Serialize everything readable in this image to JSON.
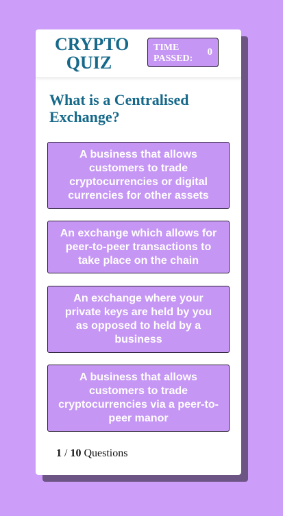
{
  "header": {
    "title": "CRYPTO QUIZ",
    "timer_label": "TIME PASSED:",
    "timer_value": "0"
  },
  "question": {
    "text": "What is a Centralised Exchange?"
  },
  "answers": [
    {
      "label": "A business that allows customers to trade cryptocurrencies or digital currencies for other assets"
    },
    {
      "label": "An exchange which allows for peer-to-peer transactions to take place on the chain"
    },
    {
      "label": "An exchange where your private keys are held by you as opposed to held by a business"
    },
    {
      "label": "A business that allows customers to trade cryptocurrencies via a peer-to-peer manor"
    }
  ],
  "progress": {
    "current": "1",
    "separator": "/",
    "total": "10",
    "suffix": "Questions"
  },
  "colors": {
    "background": "#cd9ef9",
    "card_shadow": "#6c5484",
    "accent_text": "#17698a",
    "button_fill": "#c596f3"
  }
}
